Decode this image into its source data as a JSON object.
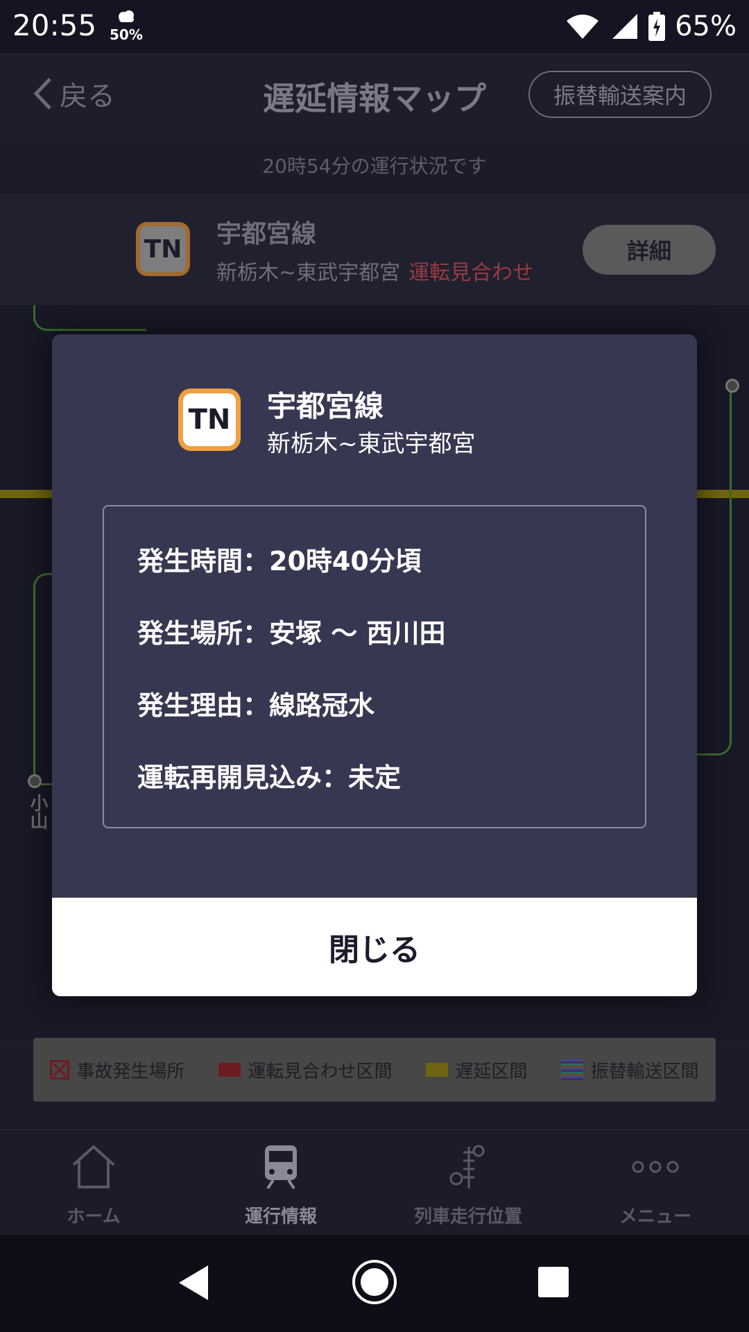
{
  "status_bar": {
    "time": "20:55",
    "weather_pct": "50%",
    "battery": "65%"
  },
  "header": {
    "back_label": "戻る",
    "title": "遅延情報マップ",
    "transfer_button": "振替輸送案内"
  },
  "status_caption": "20時54分の運行状況です",
  "line_card": {
    "badge": "TN",
    "name": "宇都宮線",
    "section": "新栃木~東武宇都宮",
    "status": "運転見合わせ",
    "detail_button": "詳細"
  },
  "map": {
    "station_oyama": "小山"
  },
  "legend": {
    "accident": "事故発生場所",
    "suspended": "運転見合わせ区間",
    "delay": "遅延区間",
    "transfer": "振替輸送区間",
    "colors": {
      "accident": "#6e1a22",
      "suspended": "#6e1a22",
      "delay": "#6f6410"
    }
  },
  "modal": {
    "badge": "TN",
    "line_name": "宇都宮線",
    "section": "新栃木~東武宇都宮",
    "info": {
      "occur_time": "発生時間：20時40分頃",
      "occur_place": "発生場所：安塚 〜 西川田",
      "reason": "発生理由：線路冠水",
      "resume": "運転再開見込み：未定"
    },
    "close_button": "閉じる"
  },
  "bottom_nav": {
    "items": [
      {
        "label": "ホーム",
        "icon": "home-icon"
      },
      {
        "label": "運行情報",
        "icon": "train-icon"
      },
      {
        "label": "列車走行位置",
        "icon": "signal-icon"
      },
      {
        "label": "メニュー",
        "icon": "more-icon"
      }
    ]
  }
}
